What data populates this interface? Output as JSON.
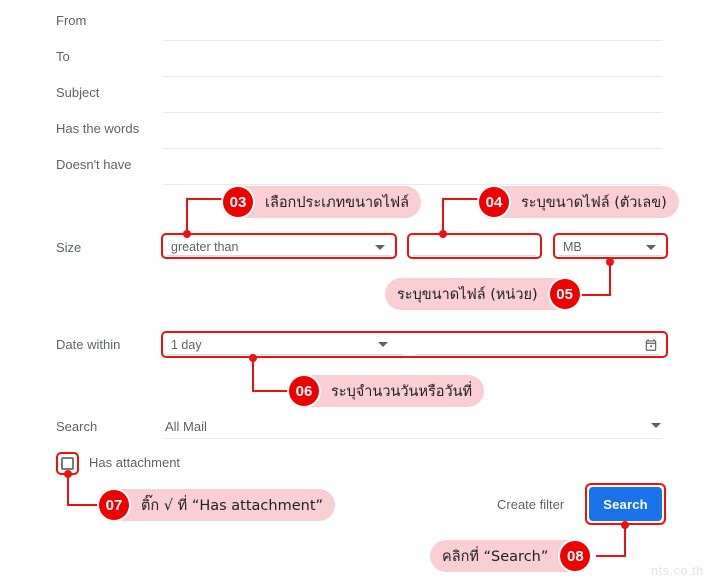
{
  "form": {
    "rows": [
      {
        "label": "From"
      },
      {
        "label": "To"
      },
      {
        "label": "Subject"
      },
      {
        "label": "Has the words"
      },
      {
        "label": "Doesn't have"
      }
    ],
    "size": {
      "label": "Size",
      "comparator_value": "greater than",
      "amount_value": "",
      "unit_value": "MB"
    },
    "date_within": {
      "label": "Date within",
      "value": "1 day",
      "date_value": "",
      "calendar_icon": "calendar-icon"
    },
    "search_scope": {
      "label": "Search",
      "value": "All Mail"
    },
    "has_attachment": {
      "label": "Has attachment",
      "checked": false
    },
    "actions": {
      "create_filter_label": "Create filter",
      "search_label": "Search"
    }
  },
  "annotations": [
    {
      "number": "03",
      "text": "เลือกประเภทขนาดไฟล์"
    },
    {
      "number": "04",
      "text": "ระบุขนาดไฟล์ (ตัวเลข)"
    },
    {
      "number": "05",
      "text": "ระบุขนาดไฟล์ (หน่วย)"
    },
    {
      "number": "06",
      "text": "ระบุจำนวนวันหรือวันที่"
    },
    {
      "number": "07",
      "text": "ติ๊ก √ ที่ “Has attachment”"
    },
    {
      "number": "08",
      "text": "คลิกที่ “Search”"
    }
  ],
  "watermark": {
    "text": "nts.co.th"
  },
  "colors": {
    "annotation_red": "#ee1111",
    "badge_red": "#ee0000",
    "callout_pink": "#f9cfd4",
    "search_blue": "#1a73e8",
    "label_gray": "#5f6368",
    "underline_gray": "#e8eaed"
  }
}
